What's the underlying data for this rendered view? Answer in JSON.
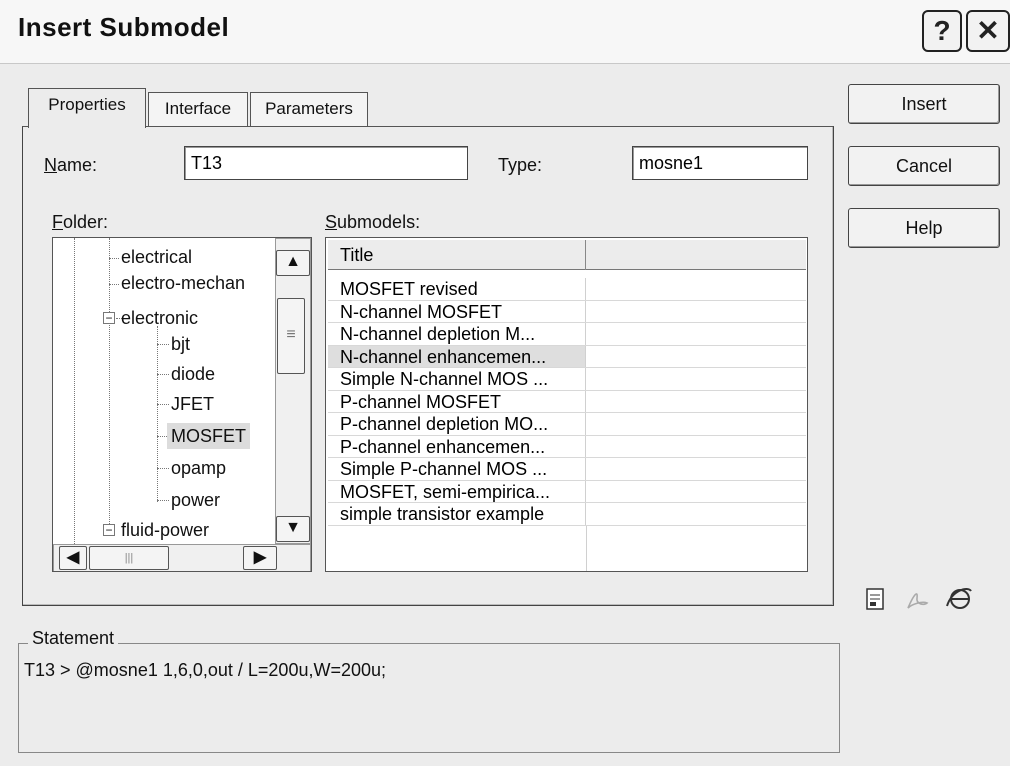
{
  "window": {
    "title": "Insert Submodel",
    "help_glyph": "?",
    "close_glyph": "✕"
  },
  "tabs": [
    {
      "label": "Properties",
      "active": true
    },
    {
      "label": "Interface",
      "active": false
    },
    {
      "label": "Parameters",
      "active": false
    }
  ],
  "properties": {
    "name_label_u": "N",
    "name_label_rest": "ame:",
    "name_value": "T13",
    "type_label": "Type:",
    "type_value": "mosne1",
    "folder_label_u": "F",
    "folder_label_rest": "older:",
    "submodels_label_u": "S",
    "submodels_label_rest": "ubmodels:"
  },
  "folder_tree": [
    {
      "label": "electrical",
      "level": 1,
      "expander": ""
    },
    {
      "label": "electro-mechan",
      "level": 1,
      "expander": ""
    },
    {
      "label": "electronic",
      "level": 1,
      "expander": "−"
    },
    {
      "label": "bjt",
      "level": 2,
      "expander": ""
    },
    {
      "label": "diode",
      "level": 2,
      "expander": ""
    },
    {
      "label": "JFET",
      "level": 2,
      "expander": ""
    },
    {
      "label": "MOSFET",
      "level": 2,
      "expander": "",
      "selected": true
    },
    {
      "label": "opamp",
      "level": 2,
      "expander": ""
    },
    {
      "label": "power",
      "level": 2,
      "expander": ""
    },
    {
      "label": "fluid-power",
      "level": 1,
      "expander": "−"
    }
  ],
  "submodels": {
    "columns": [
      "Title",
      ""
    ],
    "rows": [
      {
        "title": "MOSFET revised"
      },
      {
        "title": "N-channel MOSFET"
      },
      {
        "title": "N-channel depletion M..."
      },
      {
        "title": "N-channel enhancemen...",
        "selected": true
      },
      {
        "title": "Simple N-channel MOS ..."
      },
      {
        "title": "P-channel MOSFET"
      },
      {
        "title": "P-channel depletion MO..."
      },
      {
        "title": "P-channel enhancemen..."
      },
      {
        "title": "Simple P-channel MOS ..."
      },
      {
        "title": "MOSFET, semi-empirica..."
      },
      {
        "title": "simple transistor example"
      }
    ]
  },
  "buttons": {
    "insert": "Insert",
    "cancel": "Cancel",
    "help": "Help"
  },
  "statement": {
    "legend": "Statement",
    "text": "T13 > @mosne1 1,6,0,out / L=200u,W=200u;"
  },
  "icons": [
    "document-icon",
    "acrobat-icon",
    "browser-icon"
  ],
  "scroll_glyphs": {
    "up": "▲",
    "down": "▼",
    "left": "◀",
    "right": "▶",
    "grip": "≡",
    "hgrip": "|||"
  }
}
